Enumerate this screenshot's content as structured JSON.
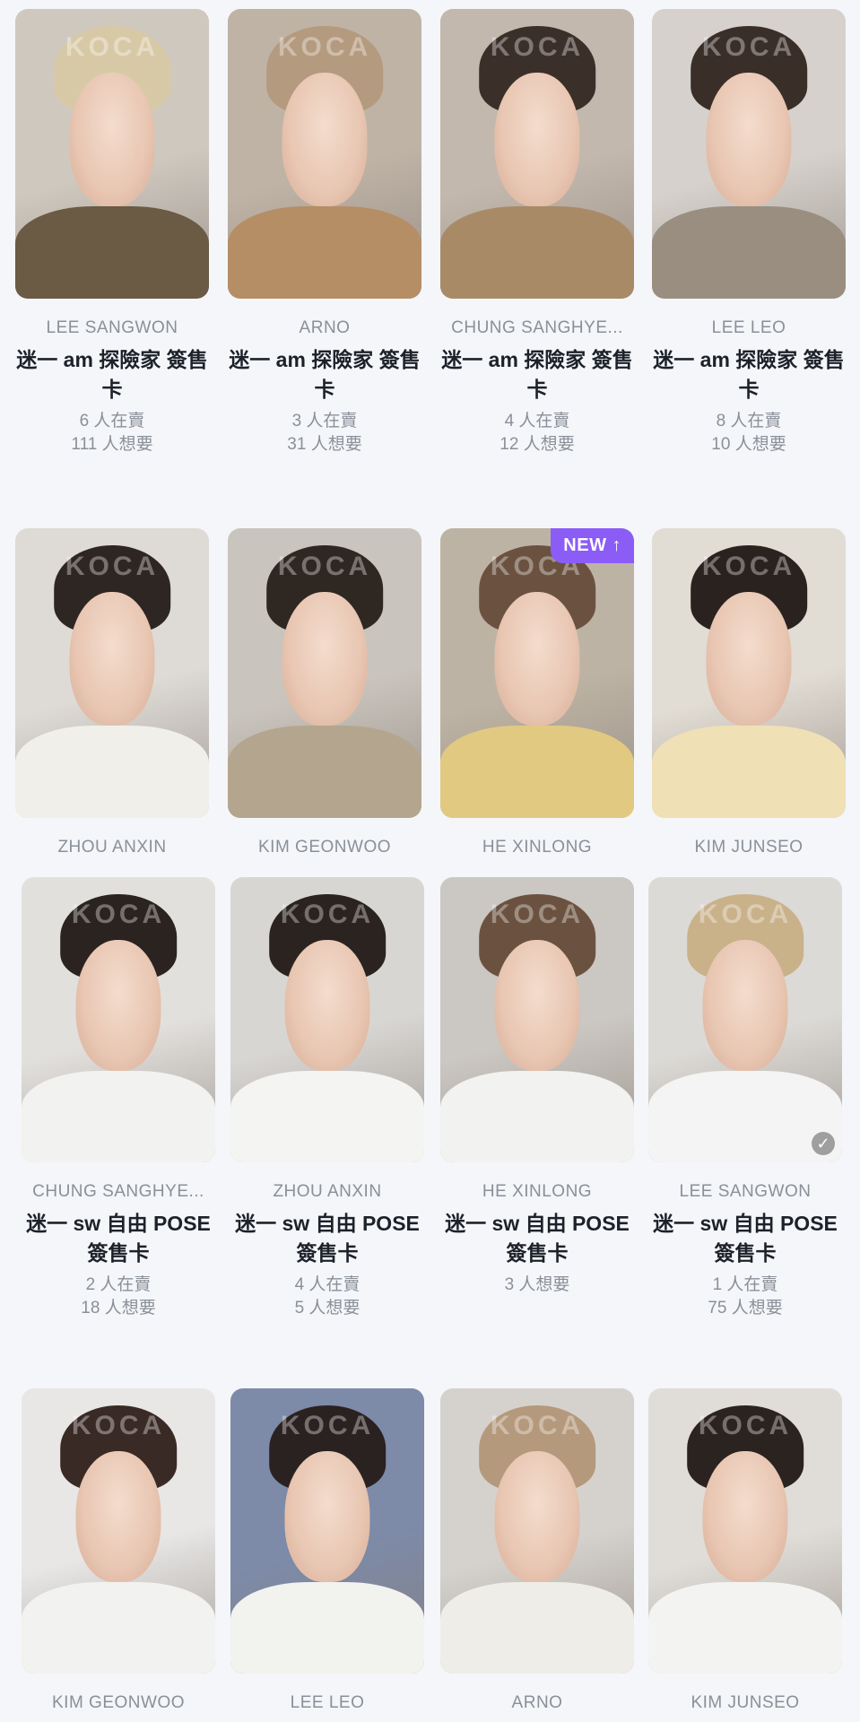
{
  "watermark": "KOCA",
  "rows": [
    {
      "cards": [
        {
          "member": "LEE SANGWON",
          "title": "迷一 am 探險家 簽售卡",
          "selling": "6 人在賣",
          "wanting": "111 人想要",
          "hair": "#d8c9a6",
          "shirt": "#6b5a44",
          "bg": "#cfc8bf"
        },
        {
          "member": "ARNO",
          "title": "迷一 am 探險家 簽售卡",
          "selling": "3 人在賣",
          "wanting": "31 人想要",
          "hair": "#b49a7e",
          "shirt": "#b58e66",
          "bg": "#bfb3a6"
        },
        {
          "member": "CHUNG SANGHYE...",
          "title": "迷一 am 探險家 簽售卡",
          "selling": "4 人在賣",
          "wanting": "12 人想要",
          "hair": "#3b2f29",
          "shirt": "#a98a67",
          "bg": "#c2b8ad"
        },
        {
          "member": "LEE LEO",
          "title": "迷一 am 探險家 簽售卡",
          "selling": "8 人在賣",
          "wanting": "10 人想要",
          "hair": "#3a2e28",
          "shirt": "#9a8e80",
          "bg": "#d6d1cc"
        }
      ]
    },
    {
      "cards": [
        {
          "member": "ZHOU ANXIN",
          "hair": "#2e2622",
          "shirt": "#f1efea",
          "bg": "#dedbd6"
        },
        {
          "member": "KIM GEONWOO",
          "hair": "#2f2722",
          "shirt": "#b4a68e",
          "bg": "#c9c4bd"
        },
        {
          "member": "HE XINLONG",
          "hair": "#6b5240",
          "shirt": "#e2c982",
          "bg": "#bdb3a4",
          "new": "NEW ↑"
        },
        {
          "member": "KIM JUNSEO",
          "hair": "#2a221e",
          "shirt": "#efe1b5",
          "bg": "#e1dcd4"
        }
      ]
    },
    {
      "cards": [
        {
          "member": "CHUNG SANGHYE...",
          "title": "迷一 sw 自由 POSE 簽售卡",
          "selling": "2 人在賣",
          "wanting": "18 人想要",
          "hair": "#2b2320",
          "shirt": "#f2f2f0",
          "bg": "#e2e0dd"
        },
        {
          "member": "ZHOU ANXIN",
          "title": "迷一 sw 自由 POSE 簽售卡",
          "selling": "4 人在賣",
          "wanting": "5 人想要",
          "hair": "#2a2320",
          "shirt": "#f4f4f2",
          "bg": "#d8d6d3"
        },
        {
          "member": "HE XINLONG",
          "title": "迷一 sw 自由 POSE 簽售卡",
          "selling": "",
          "wanting": "3 人想要",
          "hair": "#6b5240",
          "shirt": "#f2f2f0",
          "bg": "#cbc7c2"
        },
        {
          "member": "LEE SANGWON",
          "title": "迷一 sw 自由 POSE 簽售卡",
          "selling": "1 人在賣",
          "wanting": "75 人想要",
          "hair": "#c9b18a",
          "shirt": "#f4f4f4",
          "bg": "#dcdad6",
          "check": "✓"
        }
      ]
    },
    {
      "cards": [
        {
          "member": "KIM GEONWOO",
          "hair": "#3a2a25",
          "shirt": "#f2f2f0",
          "bg": "#e8e7e6"
        },
        {
          "member": "LEE LEO",
          "hair": "#2a2220",
          "shirt": "#f2f2ef",
          "bg": "#7d8aa8"
        },
        {
          "member": "ARNO",
          "hair": "#b4997c",
          "shirt": "#efede8",
          "bg": "#d5d2cd"
        },
        {
          "member": "KIM JUNSEO",
          "hair": "#2b2320",
          "shirt": "#f3f3f1",
          "bg": "#e0ddd8"
        }
      ]
    }
  ]
}
